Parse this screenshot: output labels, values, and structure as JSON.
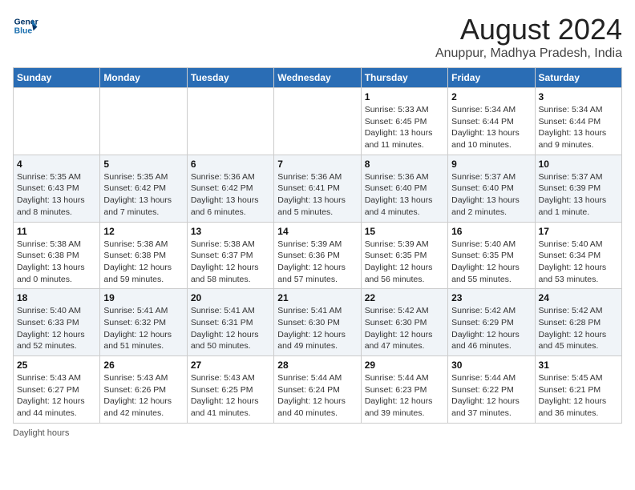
{
  "header": {
    "logo_line1": "General",
    "logo_line2": "Blue",
    "main_title": "August 2024",
    "subtitle": "Anuppur, Madhya Pradesh, India"
  },
  "days_of_week": [
    "Sunday",
    "Monday",
    "Tuesday",
    "Wednesday",
    "Thursday",
    "Friday",
    "Saturday"
  ],
  "weeks": [
    [
      {
        "day": "",
        "info": ""
      },
      {
        "day": "",
        "info": ""
      },
      {
        "day": "",
        "info": ""
      },
      {
        "day": "",
        "info": ""
      },
      {
        "day": "1",
        "info": "Sunrise: 5:33 AM\nSunset: 6:45 PM\nDaylight: 13 hours and 11 minutes."
      },
      {
        "day": "2",
        "info": "Sunrise: 5:34 AM\nSunset: 6:44 PM\nDaylight: 13 hours and 10 minutes."
      },
      {
        "day": "3",
        "info": "Sunrise: 5:34 AM\nSunset: 6:44 PM\nDaylight: 13 hours and 9 minutes."
      }
    ],
    [
      {
        "day": "4",
        "info": "Sunrise: 5:35 AM\nSunset: 6:43 PM\nDaylight: 13 hours and 8 minutes."
      },
      {
        "day": "5",
        "info": "Sunrise: 5:35 AM\nSunset: 6:42 PM\nDaylight: 13 hours and 7 minutes."
      },
      {
        "day": "6",
        "info": "Sunrise: 5:36 AM\nSunset: 6:42 PM\nDaylight: 13 hours and 6 minutes."
      },
      {
        "day": "7",
        "info": "Sunrise: 5:36 AM\nSunset: 6:41 PM\nDaylight: 13 hours and 5 minutes."
      },
      {
        "day": "8",
        "info": "Sunrise: 5:36 AM\nSunset: 6:40 PM\nDaylight: 13 hours and 4 minutes."
      },
      {
        "day": "9",
        "info": "Sunrise: 5:37 AM\nSunset: 6:40 PM\nDaylight: 13 hours and 2 minutes."
      },
      {
        "day": "10",
        "info": "Sunrise: 5:37 AM\nSunset: 6:39 PM\nDaylight: 13 hours and 1 minute."
      }
    ],
    [
      {
        "day": "11",
        "info": "Sunrise: 5:38 AM\nSunset: 6:38 PM\nDaylight: 13 hours and 0 minutes."
      },
      {
        "day": "12",
        "info": "Sunrise: 5:38 AM\nSunset: 6:38 PM\nDaylight: 12 hours and 59 minutes."
      },
      {
        "day": "13",
        "info": "Sunrise: 5:38 AM\nSunset: 6:37 PM\nDaylight: 12 hours and 58 minutes."
      },
      {
        "day": "14",
        "info": "Sunrise: 5:39 AM\nSunset: 6:36 PM\nDaylight: 12 hours and 57 minutes."
      },
      {
        "day": "15",
        "info": "Sunrise: 5:39 AM\nSunset: 6:35 PM\nDaylight: 12 hours and 56 minutes."
      },
      {
        "day": "16",
        "info": "Sunrise: 5:40 AM\nSunset: 6:35 PM\nDaylight: 12 hours and 55 minutes."
      },
      {
        "day": "17",
        "info": "Sunrise: 5:40 AM\nSunset: 6:34 PM\nDaylight: 12 hours and 53 minutes."
      }
    ],
    [
      {
        "day": "18",
        "info": "Sunrise: 5:40 AM\nSunset: 6:33 PM\nDaylight: 12 hours and 52 minutes."
      },
      {
        "day": "19",
        "info": "Sunrise: 5:41 AM\nSunset: 6:32 PM\nDaylight: 12 hours and 51 minutes."
      },
      {
        "day": "20",
        "info": "Sunrise: 5:41 AM\nSunset: 6:31 PM\nDaylight: 12 hours and 50 minutes."
      },
      {
        "day": "21",
        "info": "Sunrise: 5:41 AM\nSunset: 6:30 PM\nDaylight: 12 hours and 49 minutes."
      },
      {
        "day": "22",
        "info": "Sunrise: 5:42 AM\nSunset: 6:30 PM\nDaylight: 12 hours and 47 minutes."
      },
      {
        "day": "23",
        "info": "Sunrise: 5:42 AM\nSunset: 6:29 PM\nDaylight: 12 hours and 46 minutes."
      },
      {
        "day": "24",
        "info": "Sunrise: 5:42 AM\nSunset: 6:28 PM\nDaylight: 12 hours and 45 minutes."
      }
    ],
    [
      {
        "day": "25",
        "info": "Sunrise: 5:43 AM\nSunset: 6:27 PM\nDaylight: 12 hours and 44 minutes."
      },
      {
        "day": "26",
        "info": "Sunrise: 5:43 AM\nSunset: 6:26 PM\nDaylight: 12 hours and 42 minutes."
      },
      {
        "day": "27",
        "info": "Sunrise: 5:43 AM\nSunset: 6:25 PM\nDaylight: 12 hours and 41 minutes."
      },
      {
        "day": "28",
        "info": "Sunrise: 5:44 AM\nSunset: 6:24 PM\nDaylight: 12 hours and 40 minutes."
      },
      {
        "day": "29",
        "info": "Sunrise: 5:44 AM\nSunset: 6:23 PM\nDaylight: 12 hours and 39 minutes."
      },
      {
        "day": "30",
        "info": "Sunrise: 5:44 AM\nSunset: 6:22 PM\nDaylight: 12 hours and 37 minutes."
      },
      {
        "day": "31",
        "info": "Sunrise: 5:45 AM\nSunset: 6:21 PM\nDaylight: 12 hours and 36 minutes."
      }
    ]
  ],
  "footer": {
    "note": "Daylight hours"
  }
}
